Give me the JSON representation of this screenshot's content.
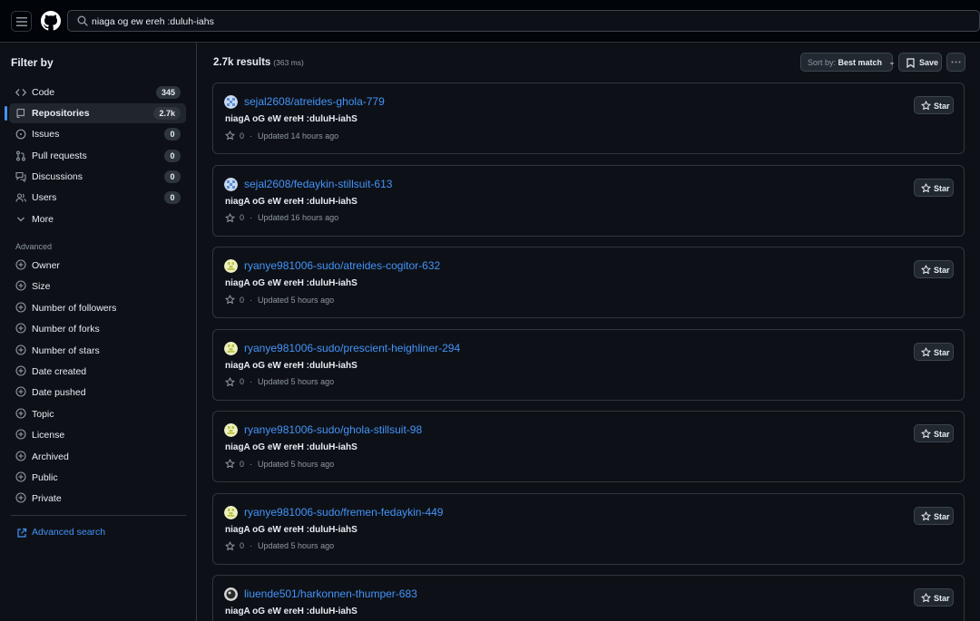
{
  "search": {
    "query": "niaga og ew ereh :duluh-iahs"
  },
  "sidebar": {
    "title": "Filter by",
    "types": [
      {
        "label": "Code",
        "count": "345",
        "icon": "code-icon"
      },
      {
        "label": "Repositories",
        "count": "2.7k",
        "icon": "repo-icon",
        "active": true
      },
      {
        "label": "Issues",
        "count": "0",
        "icon": "issue-icon"
      },
      {
        "label": "Pull requests",
        "count": "0",
        "icon": "pull-request-icon"
      },
      {
        "label": "Discussions",
        "count": "0",
        "icon": "discussion-icon"
      },
      {
        "label": "Users",
        "count": "0",
        "icon": "people-icon"
      },
      {
        "label": "More",
        "count": "",
        "icon": "chevron-down-icon"
      }
    ],
    "advanced_title": "Advanced",
    "advanced": [
      "Owner",
      "Size",
      "Number of followers",
      "Number of forks",
      "Number of stars",
      "Date created",
      "Date pushed",
      "Topic",
      "License",
      "Archived",
      "Public",
      "Private"
    ],
    "advanced_search": "Advanced search"
  },
  "results": {
    "count_label": "2.7k results",
    "time_label": "(363 ms)",
    "sort_prefix": "Sort by:",
    "sort_value": "Best match",
    "save_label": "Save",
    "star_label": "Star",
    "items": [
      {
        "repo": "sejal2608/atreides-ghola-779",
        "desc": "niagA oG eW ereH :duluH-iahS",
        "stars": "0",
        "updated": "Updated 14 hours ago",
        "avatar": "blue"
      },
      {
        "repo": "sejal2608/fedaykin-stillsuit-613",
        "desc": "niagA oG eW ereH :duluH-iahS",
        "stars": "0",
        "updated": "Updated 16 hours ago",
        "avatar": "blue"
      },
      {
        "repo": "ryanye981006-sudo/atreides-cogitor-632",
        "desc": "niagA oG eW ereH :duluH-iahS",
        "stars": "0",
        "updated": "Updated 5 hours ago",
        "avatar": "yellow"
      },
      {
        "repo": "ryanye981006-sudo/prescient-heighliner-294",
        "desc": "niagA oG eW ereH :duluH-iahS",
        "stars": "0",
        "updated": "Updated 5 hours ago",
        "avatar": "yellow"
      },
      {
        "repo": "ryanye981006-sudo/ghola-stillsuit-98",
        "desc": "niagA oG eW ereH :duluH-iahS",
        "stars": "0",
        "updated": "Updated 5 hours ago",
        "avatar": "yellow"
      },
      {
        "repo": "ryanye981006-sudo/fremen-fedaykin-449",
        "desc": "niagA oG eW ereH :duluH-iahS",
        "stars": "0",
        "updated": "Updated 5 hours ago",
        "avatar": "yellow"
      },
      {
        "repo": "liuende501/harkonnen-thumper-683",
        "desc": "niagA oG eW ereH :duluH-iahS",
        "stars": "",
        "updated": "",
        "avatar": "dark"
      }
    ]
  },
  "colors": {
    "accent": "#4493f8",
    "background": "#0d1117",
    "border": "#30363d"
  }
}
